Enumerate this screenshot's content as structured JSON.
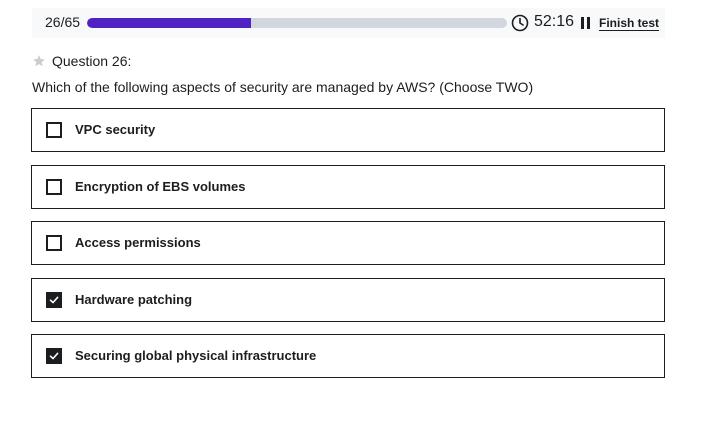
{
  "header": {
    "progress_text": "26/65",
    "progress_fraction": 0.3906,
    "timer": "52:16",
    "finish_label": "Finish test",
    "accent_color": "#5022c3",
    "icons": [
      "clock-icon",
      "pause-icon"
    ]
  },
  "question": {
    "number_label": "Question 26:",
    "text": "Which of the following aspects of security are managed by AWS? (Choose TWO)",
    "star_icon": "star-icon"
  },
  "options": [
    {
      "label": "VPC security",
      "checked": false
    },
    {
      "label": "Encryption of EBS volumes",
      "checked": false
    },
    {
      "label": "Access permissions",
      "checked": false
    },
    {
      "label": "Hardware patching",
      "checked": true
    },
    {
      "label": "Securing global physical infrastructure",
      "checked": true
    }
  ]
}
